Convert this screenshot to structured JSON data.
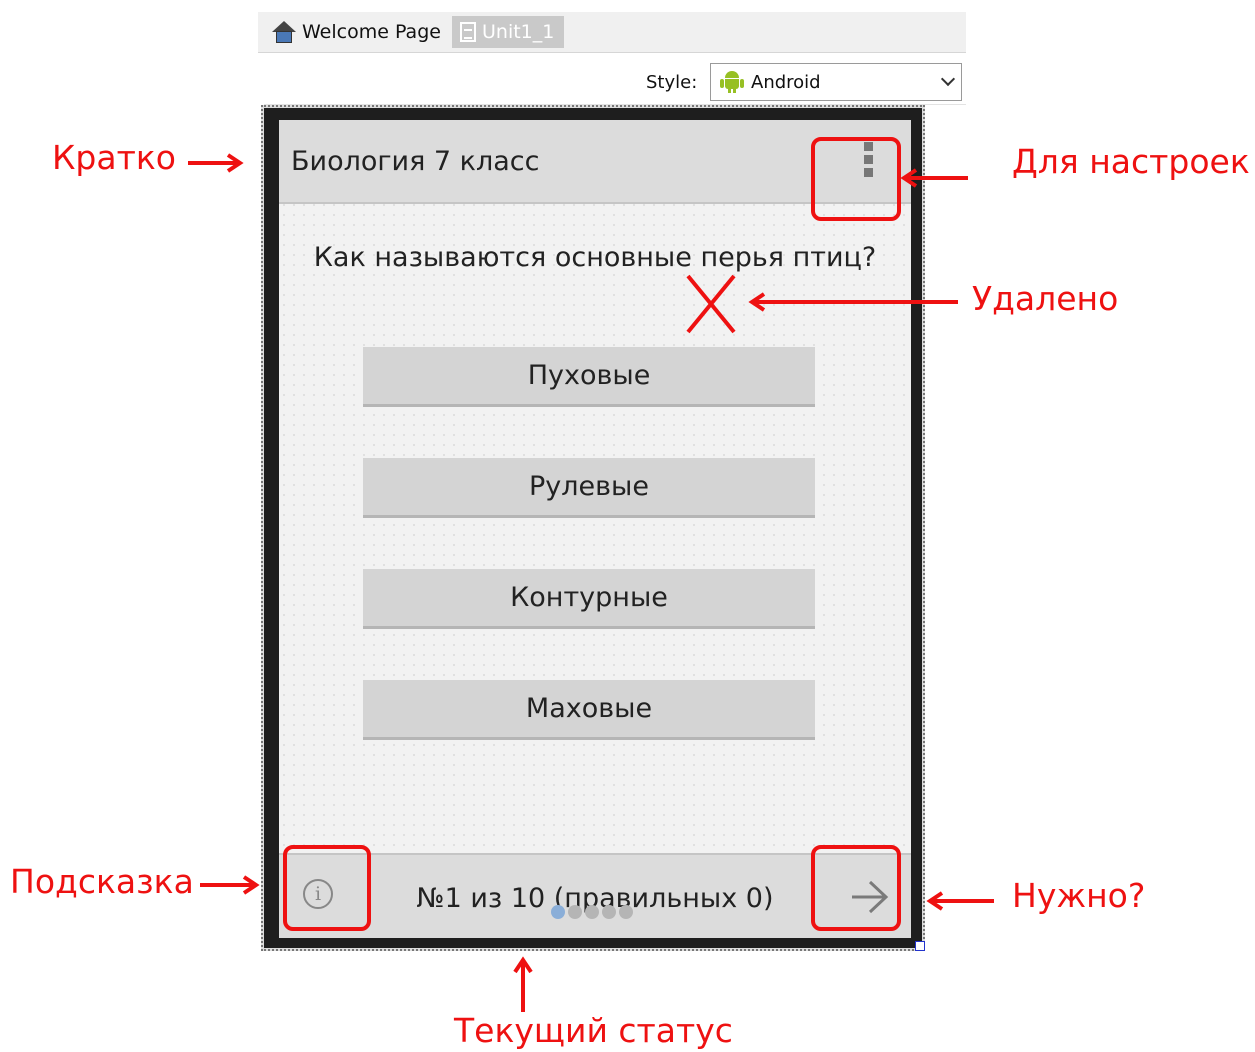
{
  "ide": {
    "tabs": [
      {
        "label": "Welcome Page",
        "icon": "home-icon",
        "active": false
      },
      {
        "label": "Unit1_1",
        "icon": "document-icon",
        "active": true
      }
    ],
    "style_label": "Style:",
    "style_value": "Android",
    "style_icon": "android-icon"
  },
  "app": {
    "title": "Биология 7 класс",
    "question": "Как называются основные перья птиц?",
    "answers": [
      "Пуховые",
      "Рулевые",
      "Контурные",
      "Маховые"
    ],
    "status": "№1 из 10 (правильных 0)",
    "page_dots": {
      "count": 5,
      "active_index": 0
    },
    "icons": {
      "menu": "overflow-menu-icon",
      "hint": "info-icon",
      "next": "arrow-right-icon"
    }
  },
  "annotations": {
    "brief": "Кратко",
    "settings": "Для настроек",
    "removed": "Удалено",
    "hint": "Подсказка",
    "needed": "Нужно?",
    "status": "Текущий статус"
  },
  "colors": {
    "annotation": "#ee1111",
    "screen_bg": "#f2f2f2",
    "bar_bg": "#dcdcdc",
    "button_bg": "#d4d4d4"
  }
}
